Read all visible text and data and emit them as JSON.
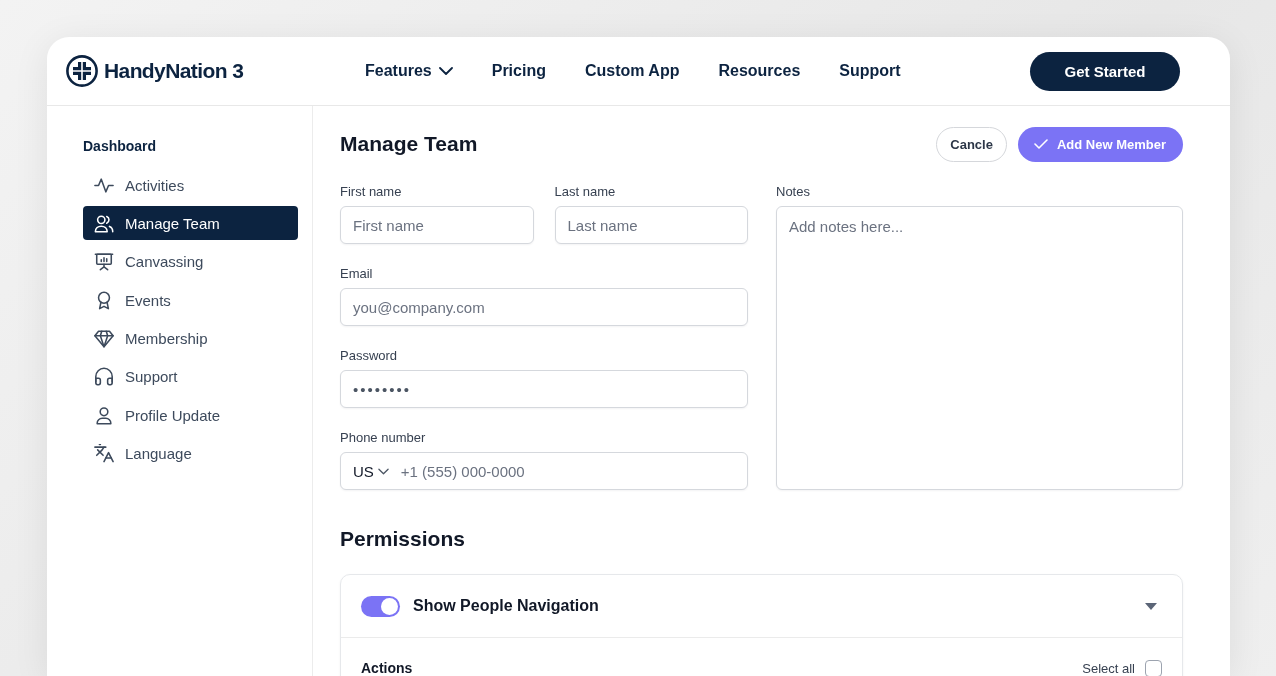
{
  "brand": {
    "name": "HandyNation 3"
  },
  "nav": {
    "items": [
      {
        "label": "Features",
        "kind": "dropdown"
      },
      {
        "label": "Pricing",
        "kind": "link"
      },
      {
        "label": "Custom App",
        "kind": "link"
      },
      {
        "label": "Resources",
        "kind": "link"
      },
      {
        "label": "Support",
        "kind": "link"
      }
    ],
    "cta": "Get Started"
  },
  "sidebar": {
    "heading": "Dashboard",
    "items": [
      {
        "label": "Activities",
        "selected": false
      },
      {
        "label": "Manage Team",
        "selected": true
      },
      {
        "label": "Canvassing",
        "selected": false
      },
      {
        "label": "Events",
        "selected": false
      },
      {
        "label": "Membership",
        "selected": false
      },
      {
        "label": "Support",
        "selected": false
      },
      {
        "label": "Profile Update",
        "selected": false
      },
      {
        "label": "Language",
        "selected": false
      }
    ]
  },
  "page": {
    "title": "Manage Team",
    "buttons": [
      {
        "label": "Cancle",
        "kind": "secondary"
      },
      {
        "label": "Add New Member",
        "kind": "primary"
      }
    ]
  },
  "form": {
    "rows": [
      [
        {
          "label": "First name",
          "kind": "text",
          "placeholder": "First name"
        },
        {
          "label": "Last name",
          "kind": "text",
          "placeholder": "Last name"
        }
      ],
      [
        {
          "label": "Email",
          "kind": "email",
          "placeholder": "you@company.com"
        }
      ],
      [
        {
          "label": "Password",
          "kind": "password",
          "value": "••••••••"
        }
      ],
      [
        {
          "label": "Phone number",
          "kind": "phone",
          "country": "US",
          "placeholder": "+1 (555) 000-0000"
        }
      ]
    ],
    "notes": {
      "label": "Notes",
      "placeholder": "Add notes here..."
    }
  },
  "permissions": {
    "title": "Permissions",
    "groups": [
      {
        "label": "Show People Navigation",
        "on": true,
        "expanded": true,
        "section": {
          "title": "Actions",
          "select_all": {
            "label": "Select all",
            "checked": false
          }
        }
      }
    ]
  }
}
